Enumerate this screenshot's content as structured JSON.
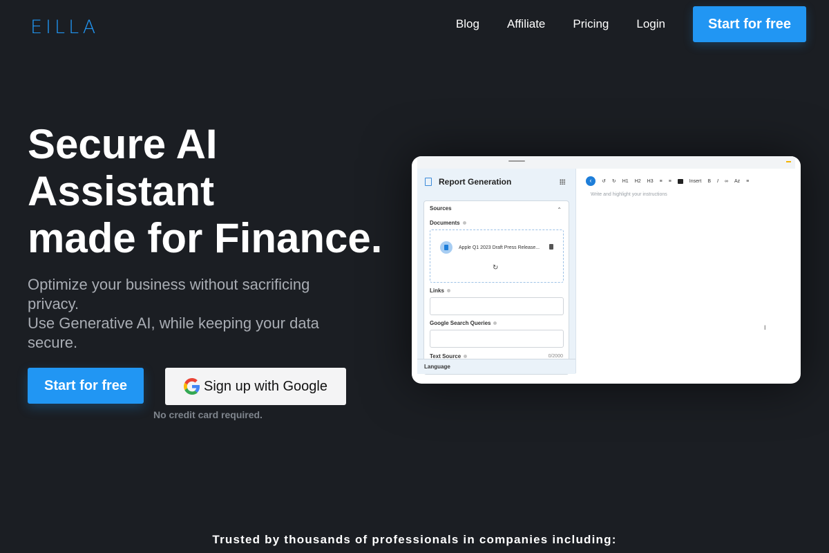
{
  "brand": {
    "logo": "EILLA",
    "accent": "#2196f3",
    "background": "#1b1e23"
  },
  "nav": {
    "links": [
      "Blog",
      "Affiliate",
      "Pricing",
      "Login"
    ],
    "cta": "Start for free"
  },
  "hero": {
    "title_lines": [
      "Secure AI",
      "Assistant",
      "made for Finance."
    ],
    "subtitle_lines": [
      "Optimize your business without sacrificing",
      "privacy.",
      "Use Generative AI, while keeping your data",
      "secure."
    ],
    "primary_cta": "Start for free",
    "google_cta": "Sign up with Google",
    "note": "No credit card required."
  },
  "preview": {
    "panel_title": "Report Generation",
    "sources_label": "Sources",
    "documents_label": "Documents",
    "file_name": "Apple Q1 2023 Draft Press Release...",
    "links_label": "Links",
    "google_queries_label": "Google Search Queries",
    "text_source_label": "Text Source",
    "text_counter": "0/2000",
    "language_label": "Language",
    "toolbar": [
      "H1",
      "H2",
      "H3",
      "Insert",
      "B",
      "I",
      "Az"
    ],
    "editor_placeholder": "Write and highlight your instructions"
  },
  "trusted_text": "Trusted by thousands of professionals in companies including:"
}
